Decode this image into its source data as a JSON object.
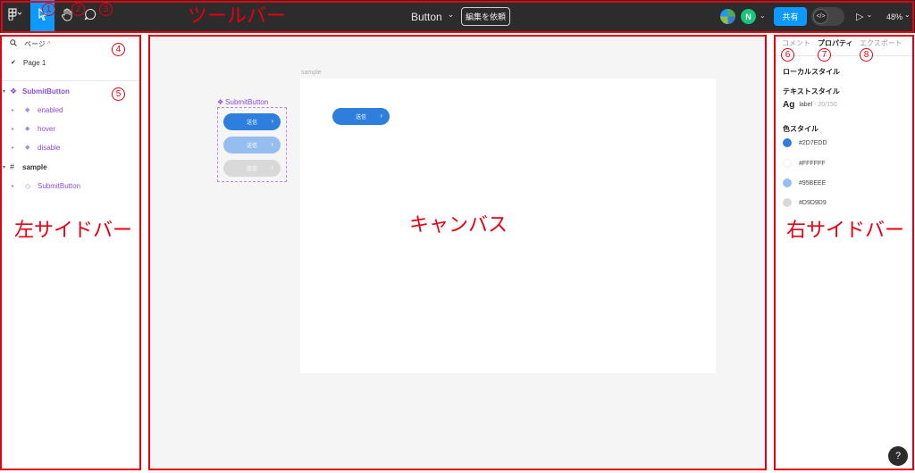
{
  "toolbar": {
    "label": "ツールバー",
    "file_title": "Button",
    "file_title_caret": "⌄",
    "request_edit": "編集を依頼",
    "avatar_initial": "N",
    "share": "共有",
    "dev_mode_icon": "</>",
    "present_icon": "▷",
    "present_caret": "⌄",
    "zoom": "48%",
    "zoom_caret": "⌄",
    "icons": [
      "figma-menu-icon",
      "move-tool-icon",
      "hand-tool-icon",
      "comment-tool-icon"
    ]
  },
  "annotations": {
    "n1": "1",
    "n2": "2",
    "n3": "3",
    "n4": "4",
    "n5": "5",
    "n6": "6",
    "n7": "7",
    "n8": "8",
    "left_sidebar": "左サイドバー",
    "canvas": "キャンバス",
    "right_sidebar": "右サイドバー",
    "color": "#e60012"
  },
  "left_sidebar": {
    "pages_label": "ページ",
    "pages_caret": "^",
    "pages": [
      {
        "name": "Page 1",
        "selected": true
      }
    ],
    "layers": [
      {
        "name": "SubmitButton",
        "type": "component-set",
        "expanded": true
      },
      {
        "name": "enabled",
        "type": "variant"
      },
      {
        "name": "hover",
        "type": "variant"
      },
      {
        "name": "disable",
        "type": "variant"
      },
      {
        "name": "sample",
        "type": "frame",
        "expanded": true
      },
      {
        "name": "SubmitButton",
        "type": "instance"
      }
    ]
  },
  "canvas": {
    "frame_name": "sample",
    "component_set_name": "SubmitButton",
    "button_label": "送信",
    "button_arrow": "›",
    "variants": [
      {
        "state": "enabled",
        "color": "#2D7EDD"
      },
      {
        "state": "hover",
        "color": "#95BEEE"
      },
      {
        "state": "disable",
        "color": "#D9D9D9"
      }
    ],
    "instance_color": "#2D7EDD",
    "background": "#f5f5f5"
  },
  "right_sidebar": {
    "tabs": [
      "コメント",
      "プロパティ",
      "エクスポート"
    ],
    "active_tab": "プロパティ",
    "local_styles": "ローカルスタイル",
    "text_styles": "テキストスタイル",
    "text_style_glyph": "Ag",
    "text_style_name": "label",
    "text_style_spec": "· 20/150",
    "color_styles": "色スタイル",
    "colors": [
      {
        "hex": "#2D7EDD",
        "label": "#2D7EDD"
      },
      {
        "hex": "#FFFFFF",
        "label": "#FFFFFF"
      },
      {
        "hex": "#95BEEE",
        "label": "#95BEEE"
      },
      {
        "hex": "#D9D9D9",
        "label": "#D9D9D9"
      }
    ],
    "help": "?"
  }
}
